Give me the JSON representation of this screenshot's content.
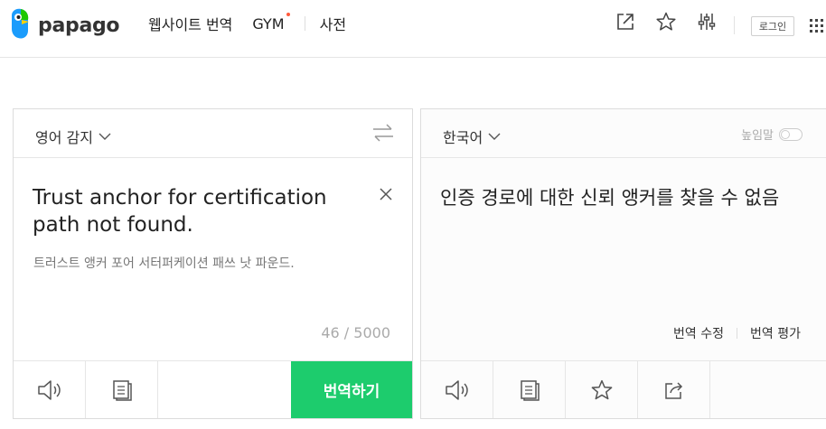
{
  "brand": {
    "name": "papago",
    "colors": {
      "primary_green": "#1dcc6d",
      "logo_blue": "#1b9cfc",
      "logo_yellow": "#ffd200",
      "logo_green": "#1ec800"
    }
  },
  "nav": {
    "items": [
      "웹사이트 번역",
      "GYM",
      "사전"
    ]
  },
  "header_actions": {
    "open_new_window_icon": "external-link-icon",
    "favorites_icon": "star-icon",
    "settings_icon": "sliders-icon",
    "login_label": "로그인",
    "apps_icon": "grid-icon"
  },
  "source": {
    "language": "영어 감지",
    "text": "Trust anchor for certification path not found.",
    "pronunciation": "트러스트 앵커 포어 서터퍼케이션 패쓰 낫 파운드.",
    "counter": "46 / 5000",
    "translate_button": "번역하기"
  },
  "target": {
    "language": "한국어",
    "honorific_label": "높임말",
    "honorific_on": false,
    "text": "인증 경로에 대한 신뢰 앵커를 찾을 수 없음",
    "edit_link": "번역 수정",
    "rate_link": "번역 평가"
  }
}
